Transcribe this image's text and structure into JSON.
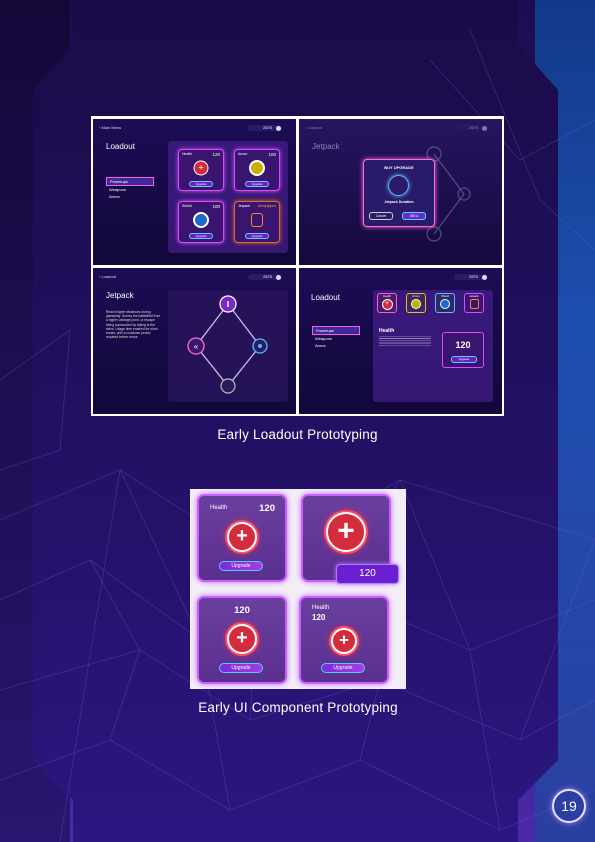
{
  "captions": {
    "loadout": "Early Loadout Prototyping",
    "component": "Early UI Component Prototyping"
  },
  "page_number": "19",
  "screens": {
    "s1": {
      "back": "Main Menu",
      "coins": "2570",
      "title": "Loadout",
      "menu": [
        "Powerups",
        "Weapons",
        "Armor"
      ],
      "cards": [
        {
          "label": "Health",
          "value": "120",
          "button": "Upgrade"
        },
        {
          "label": "Armor",
          "value": "100",
          "button": "Upgrade"
        },
        {
          "label": "Shield",
          "value": "100",
          "button": "Upgrade"
        },
        {
          "label": "Jetpack",
          "value": "Unequipped",
          "button": "Upgrade"
        }
      ]
    },
    "s2": {
      "back": "Loadout",
      "coins": "2570",
      "title": "Jetpack",
      "dialog_title": "BUY UPGRADE",
      "dialog_item": "Jetpack Duration",
      "cancel": "Cancel",
      "price": "350"
    },
    "s3": {
      "back": "Loadout",
      "coins": "2570",
      "title": "Jetpack",
      "description": "Reach higher distances during gameplay. Survey the battlefield from a higher vantage point, or escape being surrounded by taking to the skies. Usage time enabled for short bursts, with a cooldown period required before reuse."
    },
    "s4": {
      "coins": "2570",
      "title": "Loadout",
      "menu": [
        "Powerups",
        "Weapons",
        "Armor"
      ],
      "tabs": [
        "Health",
        "Armor",
        "Shield",
        "Jetpack"
      ],
      "detail_title": "Health",
      "detail_value": "120",
      "detail_button": "Upgrade"
    }
  },
  "components": {
    "card1": {
      "label": "Health",
      "value": "120",
      "button": "Upgrade"
    },
    "card2": {
      "value": "120"
    },
    "card3": {
      "value": "120",
      "button": "Upgrade"
    },
    "card4": {
      "label": "Health",
      "value": "120",
      "button": "Upgrade"
    }
  }
}
